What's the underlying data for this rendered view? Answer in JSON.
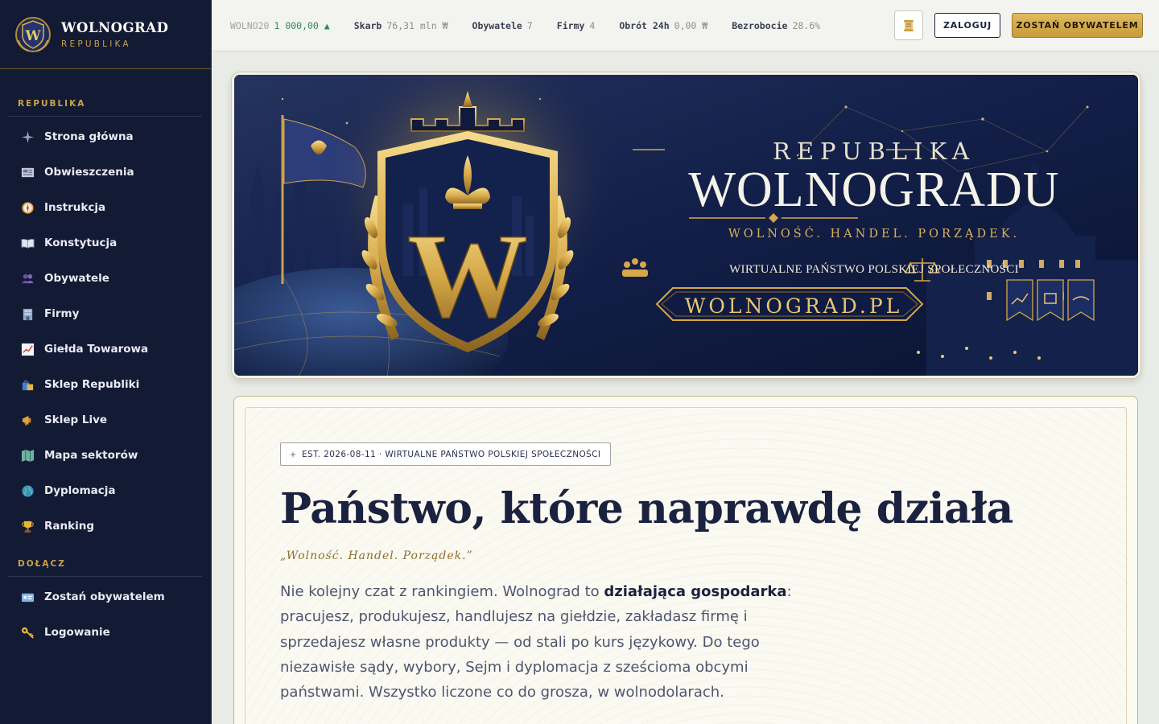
{
  "brand": {
    "title": "WOLNOGRAD",
    "subtitle": "REPUBLIKA"
  },
  "sidebar": {
    "sections": [
      {
        "title": "REPUBLIKA",
        "items": [
          {
            "label": "Strona główna",
            "icon": "compass-star-icon"
          },
          {
            "label": "Obwieszczenia",
            "icon": "newspaper-icon"
          },
          {
            "label": "Instrukcja",
            "icon": "compass-icon"
          },
          {
            "label": "Konstytucja",
            "icon": "open-book-icon"
          },
          {
            "label": "Obywatele",
            "icon": "people-icon"
          },
          {
            "label": "Firmy",
            "icon": "office-building-icon"
          },
          {
            "label": "Giełda Towarowa",
            "icon": "chart-up-icon"
          },
          {
            "label": "Sklep Republiki",
            "icon": "shopping-bags-icon"
          },
          {
            "label": "Sklep Live",
            "icon": "megaphone-icon"
          },
          {
            "label": "Mapa sektorów",
            "icon": "map-icon"
          },
          {
            "label": "Dyplomacja",
            "icon": "globe-icon"
          },
          {
            "label": "Ranking",
            "icon": "trophy-icon"
          }
        ]
      },
      {
        "title": "DOŁĄCZ",
        "items": [
          {
            "label": "Zostań obywatelem",
            "icon": "id-card-icon"
          },
          {
            "label": "Logowanie",
            "icon": "key-icon"
          }
        ]
      }
    ]
  },
  "ticker": [
    {
      "label": "WOLNO20",
      "value": "1 000,00 ▲"
    },
    {
      "label": "Skarb",
      "value": "76,31 mln ₩"
    },
    {
      "label": "Obywatele",
      "value": "7"
    },
    {
      "label": "Firmy",
      "value": "4"
    },
    {
      "label": "Obrót 24h",
      "value": "0,00 ₩"
    },
    {
      "label": "Bezrobocie",
      "value": "28.6%"
    }
  ],
  "header": {
    "login_label": "ZALOGUJ",
    "citizen_label": "ZOSTAŃ OBYWATELEM",
    "scroll_icon": "scroll-icon"
  },
  "banner": {
    "republika": "REPUBLIKA",
    "wolnogradu": "WOLNOGRADU",
    "motto": "WOLNOŚĆ. HANDEL. PORZĄDEK.",
    "tagline": "WIRTUALNE PAŃSTWO POLSKIEJ SPOŁECZNOŚCI",
    "domain": "WOLNOGRAD.PL",
    "crest_letter": "W"
  },
  "hero": {
    "badge": "EST. 2026-08-11 · WIRTUALNE PAŃSTWO POLSKIEJ SPOŁECZNOŚCI",
    "headline": "Państwo, które naprawdę działa",
    "motto": "„Wolność. Handel. Porządek.”",
    "para_1": "Nie kolejny czat z rankingiem. Wolnograd to ",
    "para_bold": "działająca gospodarka",
    "para_2": ": pracujesz, produkujesz, handlujesz na giełdzie, zakładasz firmę i sprzedajesz własne produkty — od stali po kurs językowy. Do tego niezawisłe sądy, wybory, Sejm i dyplomacja z sześcioma obcymi państwami. Wszystko liczone co do grosza, w wolnodolarach."
  },
  "colors": {
    "sidebar_bg": "#131a33",
    "gold": "#c9a24b",
    "navy": "#1b2240",
    "up_green": "#2e8a57"
  }
}
